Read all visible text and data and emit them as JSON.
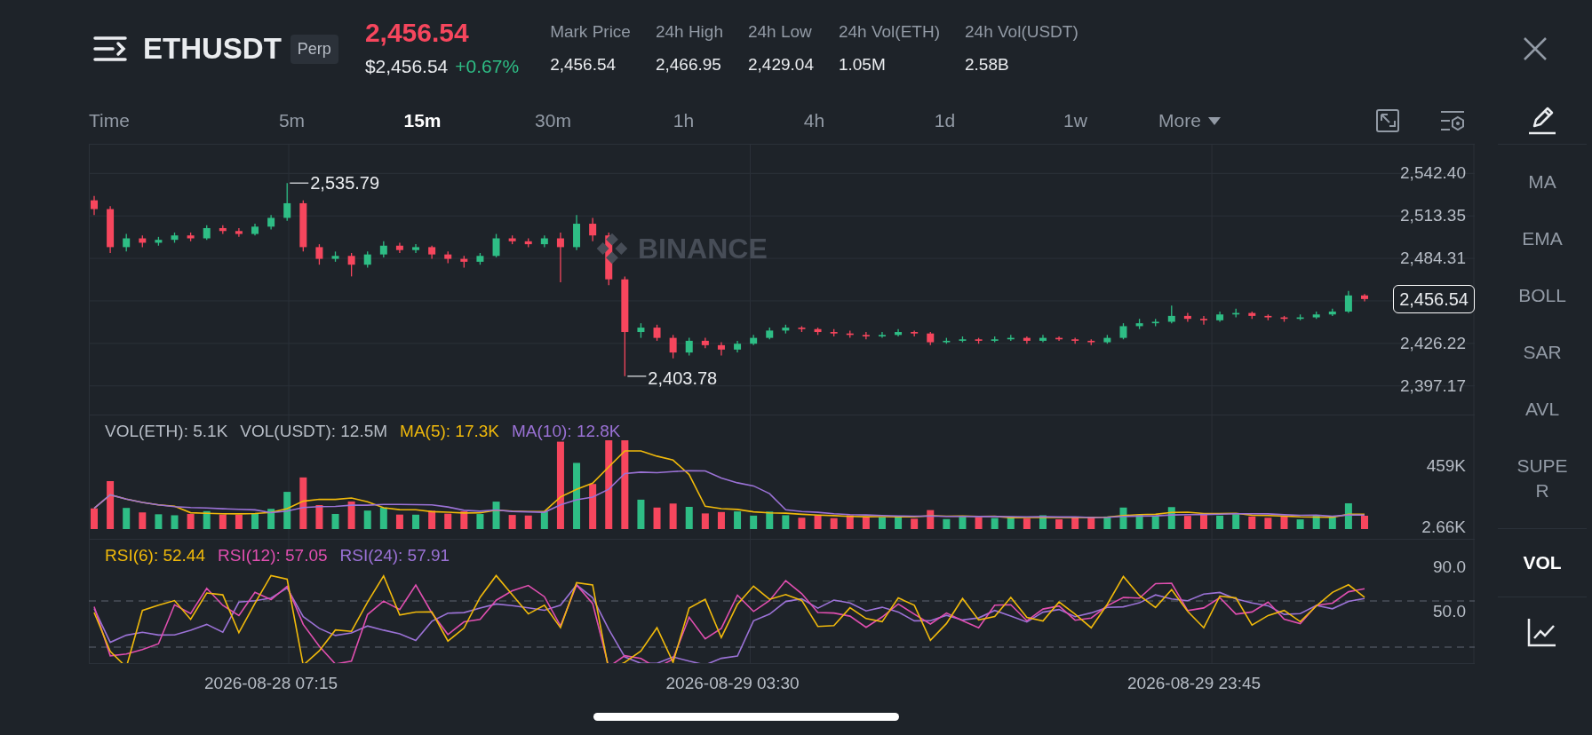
{
  "header": {
    "title": "ETHUSDT",
    "badge": "Perp",
    "last_price": "2,456.54",
    "usd_price": "$2,456.54",
    "change": "+0.67%"
  },
  "stats": [
    {
      "label": "Mark Price",
      "value": "2,456.54"
    },
    {
      "label": "24h High",
      "value": "2,466.95"
    },
    {
      "label": "24h Low",
      "value": "2,429.04"
    },
    {
      "label": "24h Vol(ETH)",
      "value": "1.05M"
    },
    {
      "label": "24h Vol(USDT)",
      "value": "2.58B"
    }
  ],
  "timeframes": [
    {
      "label": "Time",
      "selected": false
    },
    {
      "label": "5m",
      "selected": false
    },
    {
      "label": "15m",
      "selected": true
    },
    {
      "label": "30m",
      "selected": false
    },
    {
      "label": "1h",
      "selected": false
    },
    {
      "label": "4h",
      "selected": false
    },
    {
      "label": "1d",
      "selected": false
    },
    {
      "label": "1w",
      "selected": false
    }
  ],
  "more": {
    "label": "More"
  },
  "indicators": [
    {
      "label": "MA",
      "selected": false
    },
    {
      "label": "EMA",
      "selected": false
    },
    {
      "label": "BOLL",
      "selected": false
    },
    {
      "label": "SAR",
      "selected": false
    },
    {
      "label": "AVL",
      "selected": false
    },
    {
      "label": "SUPER",
      "selected": false
    }
  ],
  "sub_indicators": [
    {
      "label": "VOL",
      "selected": true
    }
  ],
  "price_chart": {
    "watermark": "BINANCE",
    "high_label": "2,535.79",
    "low_label": "2,403.78",
    "current_price": "2,456.54",
    "chart_data": {
      "type": "candlestick",
      "categories": [
        null,
        null,
        null,
        null,
        null,
        null,
        null,
        null,
        null,
        null,
        null,
        null,
        null,
        null,
        null,
        null,
        null,
        null,
        null,
        null,
        null,
        null,
        null,
        null,
        null,
        null,
        null,
        null,
        null,
        null,
        null,
        null,
        null,
        null,
        null,
        null,
        null,
        null,
        null,
        null,
        null,
        null,
        null,
        null,
        null,
        null,
        null,
        null,
        null,
        null,
        null,
        null,
        null,
        null,
        null,
        null,
        null,
        null,
        null,
        null,
        null,
        null,
        null,
        null,
        null,
        null,
        null,
        null,
        null,
        null,
        null,
        null,
        null,
        null,
        null,
        null,
        null,
        null,
        null,
        null
      ],
      "ohlc": [
        [
          2524,
          2527,
          2514,
          2518
        ],
        [
          2518,
          2520,
          2488,
          2492
        ],
        [
          2492,
          2501,
          2489,
          2498
        ],
        [
          2498,
          2500,
          2492,
          2495
        ],
        [
          2495,
          2499,
          2493,
          2497
        ],
        [
          2497,
          2502,
          2495,
          2500
        ],
        [
          2500,
          2502,
          2496,
          2498
        ],
        [
          2498,
          2507,
          2497,
          2505
        ],
        [
          2505,
          2507,
          2501,
          2503
        ],
        [
          2503,
          2505,
          2499,
          2501
        ],
        [
          2501,
          2508,
          2500,
          2506
        ],
        [
          2506,
          2514,
          2504,
          2512
        ],
        [
          2512,
          2535.79,
          2510,
          2522
        ],
        [
          2522,
          2524,
          2489,
          2492
        ],
        [
          2492,
          2494,
          2480,
          2484
        ],
        [
          2484,
          2489,
          2482,
          2486
        ],
        [
          2486,
          2488,
          2472,
          2480
        ],
        [
          2480,
          2489,
          2478,
          2487
        ],
        [
          2487,
          2496,
          2485,
          2493
        ],
        [
          2493,
          2495,
          2488,
          2490
        ],
        [
          2490,
          2494,
          2488,
          2492
        ],
        [
          2492,
          2493,
          2484,
          2487
        ],
        [
          2487,
          2489,
          2481,
          2484
        ],
        [
          2484,
          2486,
          2478,
          2482
        ],
        [
          2482,
          2488,
          2480,
          2486
        ],
        [
          2486,
          2501,
          2485,
          2498
        ],
        [
          2498,
          2500,
          2494,
          2496
        ],
        [
          2496,
          2498,
          2492,
          2494
        ],
        [
          2494,
          2500,
          2492,
          2498
        ],
        [
          2498,
          2502,
          2468,
          2492
        ],
        [
          2492,
          2514,
          2490,
          2508
        ],
        [
          2508,
          2512,
          2496,
          2500
        ],
        [
          2500,
          2502,
          2466,
          2470
        ],
        [
          2470,
          2472,
          2403.78,
          2434
        ],
        [
          2434,
          2440,
          2430,
          2437
        ],
        [
          2437,
          2439,
          2428,
          2430
        ],
        [
          2430,
          2432,
          2416,
          2420
        ],
        [
          2420,
          2430,
          2418,
          2428
        ],
        [
          2428,
          2430,
          2423,
          2425
        ],
        [
          2425,
          2427,
          2418,
          2422
        ],
        [
          2422,
          2428,
          2420,
          2426
        ],
        [
          2426,
          2432,
          2425,
          2430
        ],
        [
          2430,
          2437,
          2429,
          2435
        ],
        [
          2435,
          2439,
          2433,
          2437
        ],
        [
          2437,
          2438,
          2434,
          2436
        ],
        [
          2436,
          2437,
          2432,
          2434
        ],
        [
          2434,
          2436,
          2431,
          2433
        ],
        [
          2433,
          2435,
          2430,
          2432
        ],
        [
          2432,
          2434,
          2429,
          2431
        ],
        [
          2431,
          2434,
          2430,
          2432
        ],
        [
          2432,
          2436,
          2431,
          2434
        ],
        [
          2434,
          2435,
          2431,
          2433
        ],
        [
          2433,
          2434,
          2425,
          2427
        ],
        [
          2427,
          2430,
          2426,
          2428
        ],
        [
          2428,
          2431,
          2427,
          2429
        ],
        [
          2429,
          2430,
          2426,
          2428
        ],
        [
          2428,
          2431,
          2427,
          2429
        ],
        [
          2429,
          2432,
          2428,
          2430
        ],
        [
          2430,
          2431,
          2426,
          2428
        ],
        [
          2428,
          2432,
          2427,
          2430
        ],
        [
          2430,
          2431,
          2428,
          2429
        ],
        [
          2429,
          2430,
          2426,
          2428
        ],
        [
          2428,
          2429,
          2425,
          2427
        ],
        [
          2427,
          2432,
          2426,
          2430
        ],
        [
          2430,
          2440,
          2429,
          2438
        ],
        [
          2438,
          2443,
          2436,
          2440
        ],
        [
          2440,
          2443,
          2438,
          2441
        ],
        [
          2441,
          2452,
          2440,
          2445
        ],
        [
          2445,
          2447,
          2441,
          2443
        ],
        [
          2443,
          2445,
          2439,
          2442
        ],
        [
          2442,
          2448,
          2441,
          2446
        ],
        [
          2446,
          2450,
          2444,
          2447
        ],
        [
          2447,
          2448,
          2443,
          2445
        ],
        [
          2445,
          2446,
          2442,
          2444
        ],
        [
          2444,
          2445,
          2441,
          2443
        ],
        [
          2443,
          2446,
          2442,
          2444
        ],
        [
          2444,
          2448,
          2443,
          2446
        ],
        [
          2446,
          2450,
          2445,
          2448
        ],
        [
          2448,
          2462,
          2447,
          2459
        ],
        [
          2459,
          2460,
          2455,
          2456.54
        ]
      ],
      "ylim": [
        2377,
        2562
      ],
      "yticks": [
        {
          "value": 2542.4,
          "label": "2,542.40"
        },
        {
          "value": 2513.35,
          "label": "2,513.35"
        },
        {
          "value": 2484.31,
          "label": "2,484.31"
        },
        {
          "value": 2426.22,
          "label": "2,426.22"
        },
        {
          "value": 2397.17,
          "label": "2,397.17"
        }
      ],
      "grid": true
    }
  },
  "time_axis": [
    "2026-08-28 07:15",
    "2026-08-29 03:30",
    "2026-08-29 23:45"
  ],
  "volume_panel": {
    "legend": [
      {
        "text": "VOL(ETH): 5.1K",
        "color": "#b7bdc6"
      },
      {
        "text": "VOL(USDT): 12.5M",
        "color": "#b7bdc6"
      },
      {
        "text": "MA(5): 17.3K",
        "color": "#f0b90b"
      },
      {
        "text": "MA(10): 12.8K",
        "color": "#9b72d6"
      }
    ],
    "axis_labels": [
      "459K",
      "2.66K"
    ]
  },
  "rsi_panel": {
    "legend": [
      {
        "text": "RSI(6): 52.44",
        "color": "#f0b90b"
      },
      {
        "text": "RSI(12): 57.05",
        "color": "#e04fb0"
      },
      {
        "text": "RSI(24): 57.91",
        "color": "#9b72d6"
      }
    ],
    "axis_labels": [
      "90.0",
      "50.0"
    ]
  }
}
